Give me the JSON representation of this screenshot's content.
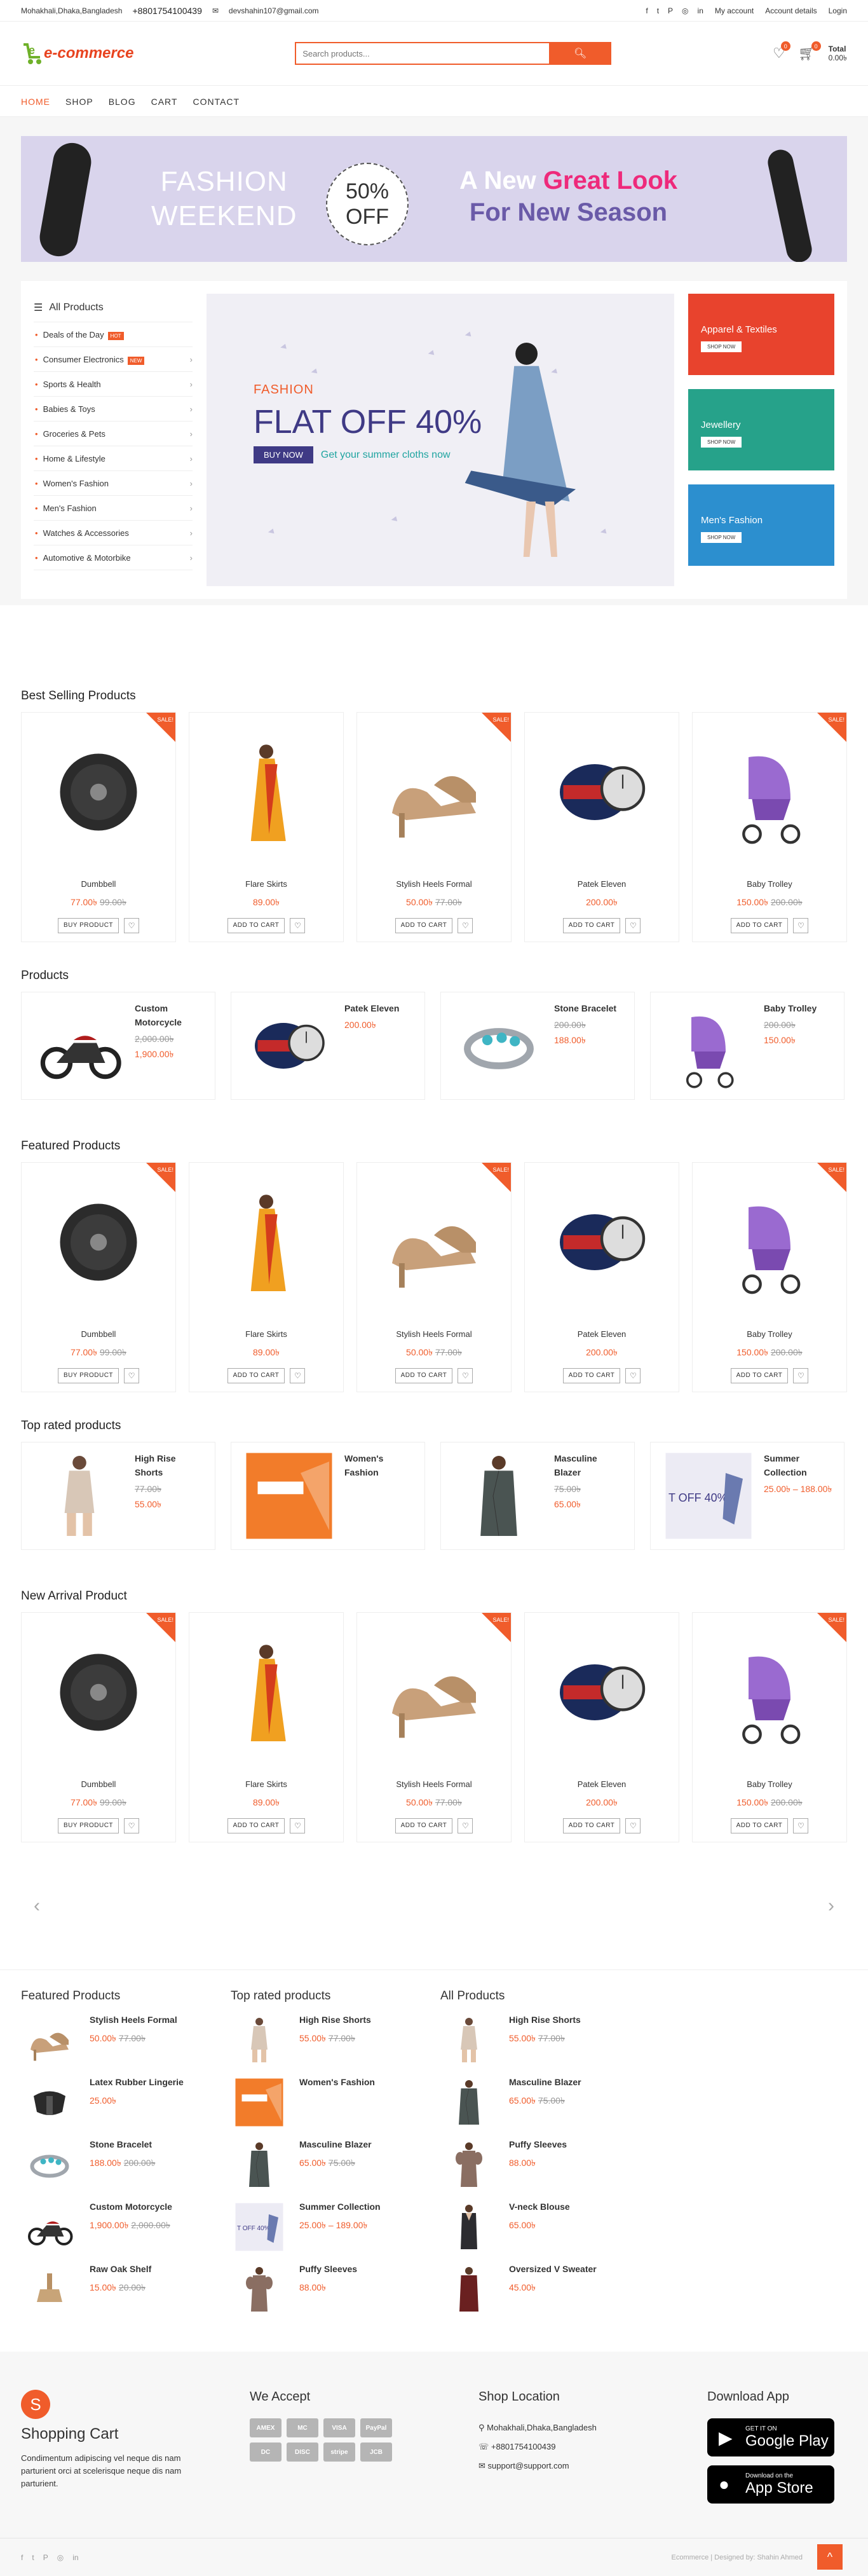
{
  "topbar": {
    "address": "Mohakhali,Dhaka,Bangladesh",
    "phone": "+8801754100439",
    "email": "devshahin107@gmail.com",
    "links": [
      "My account",
      "Account details",
      "Login"
    ]
  },
  "header": {
    "logo": "e-commerce",
    "search_placeholder": "Search products...",
    "wishlist_count": "0",
    "cart_count": "0",
    "cart_label": "Total",
    "cart_total": "0.00৳"
  },
  "nav": [
    "HOME",
    "SHOP",
    "BLOG",
    "CART",
    "CONTACT"
  ],
  "banner": {
    "line1": "FASHION",
    "line2": "WEEKEND",
    "badge1": "50%",
    "badge2": "OFF",
    "new": "A New",
    "great": "Great Look",
    "for": "For New Season"
  },
  "categories": {
    "title": "All Products",
    "items": [
      {
        "label": "Deals of the Day",
        "tag": "HOT",
        "tagcolor": "#f05c2b",
        "arrow": false
      },
      {
        "label": "Consumer Electronics",
        "tag": "NEW",
        "tagcolor": "#f05c2b",
        "arrow": true
      },
      {
        "label": "Sports & Health",
        "tag": "",
        "arrow": true
      },
      {
        "label": "Babies & Toys",
        "tag": "",
        "arrow": true
      },
      {
        "label": "Groceries & Pets",
        "tag": "",
        "arrow": true
      },
      {
        "label": "Home & Lifestyle",
        "tag": "",
        "arrow": true
      },
      {
        "label": "Women's Fashion",
        "tag": "",
        "arrow": true
      },
      {
        "label": "Men's Fashion",
        "tag": "",
        "arrow": true
      },
      {
        "label": "Watches & Accessories",
        "tag": "",
        "arrow": true
      },
      {
        "label": "Automotive & Motorbike",
        "tag": "",
        "arrow": true
      }
    ]
  },
  "hero": {
    "kicker": "FASHION",
    "headline": "FLAT OFF 40%",
    "button": "BUY NOW",
    "tagline": "Get your summer cloths now"
  },
  "side_banners": [
    {
      "title": "Apparel & Textiles",
      "btn": "SHOP NOW",
      "color": "#e8432d"
    },
    {
      "title": "Jewellery",
      "btn": "SHOP NOW",
      "color": "#26a28a"
    },
    {
      "title": "Men's Fashion",
      "btn": "SHOP NOW",
      "color": "#2c8fcf"
    }
  ],
  "best_selling": {
    "title": "Best Selling Products"
  },
  "products_title": "Products",
  "featured_title": "Featured Products",
  "top_rated_title": "Top rated products",
  "new_arrival_title": "New Arrival Product",
  "grid_products": [
    {
      "name": "Dumbbell",
      "price": "77.00৳",
      "old": "99.00৳",
      "btn": "BUY PRODUCT",
      "sale": true,
      "icon": "dumbbell-plate"
    },
    {
      "name": "Flare Skirts",
      "price": "89.00৳",
      "old": "",
      "btn": "ADD TO CART",
      "sale": false,
      "icon": "saree"
    },
    {
      "name": "Stylish Heels Formal",
      "price": "50.00৳",
      "old": "77.00৳",
      "btn": "ADD TO CART",
      "sale": true,
      "icon": "heels"
    },
    {
      "name": "Patek Eleven",
      "price": "200.00৳",
      "old": "",
      "btn": "ADD TO CART",
      "sale": false,
      "icon": "watch"
    },
    {
      "name": "Baby Trolley",
      "price": "150.00৳",
      "old": "200.00৳",
      "btn": "ADD TO CART",
      "sale": true,
      "icon": "stroller"
    }
  ],
  "products_h": [
    {
      "name": "Custom Motorcycle",
      "price": "1,900.00৳",
      "old": "2,000.00৳",
      "icon": "motorcycle"
    },
    {
      "name": "Patek Eleven",
      "price": "200.00৳",
      "old": "",
      "icon": "watch"
    },
    {
      "name": "Stone Bracelet",
      "price": "188.00৳",
      "old": "200.00৳",
      "icon": "bracelet"
    },
    {
      "name": "Baby Trolley",
      "price": "150.00৳",
      "old": "200.00৳",
      "icon": "stroller"
    }
  ],
  "top_rated_h": [
    {
      "name": "High Rise Shorts",
      "price": "55.00৳",
      "old": "77.00৳",
      "icon": "shorts"
    },
    {
      "name": "Women's Fashion",
      "price": "",
      "old": "",
      "icon": "fashion-banner"
    },
    {
      "name": "Masculine Blazer",
      "price": "65.00৳",
      "old": "75.00৳",
      "icon": "blazer"
    },
    {
      "name": "Summer Collection",
      "price": "25.00৳ – 188.00৳",
      "old": "",
      "icon": "summer"
    }
  ],
  "footer_lists": [
    {
      "title": "Featured Products",
      "items": [
        {
          "name": "Stylish Heels Formal",
          "price": "50.00৳",
          "old": "77.00৳",
          "icon": "heels"
        },
        {
          "name": "Latex Rubber Lingerie",
          "price": "25.00৳",
          "old": "",
          "icon": "lingerie"
        },
        {
          "name": "Stone Bracelet",
          "price": "188.00৳",
          "old": "200.00৳",
          "icon": "bracelet"
        },
        {
          "name": "Custom Motorcycle",
          "price": "1,900.00৳",
          "old": "2,000.00৳",
          "icon": "motorcycle"
        },
        {
          "name": "Raw Oak Shelf",
          "price": "15.00৳",
          "old": "20.00৳",
          "icon": "shelf"
        }
      ]
    },
    {
      "title": "Top rated products",
      "items": [
        {
          "name": "High Rise Shorts",
          "price": "55.00৳",
          "old": "77.00৳",
          "icon": "shorts"
        },
        {
          "name": "Women's Fashion",
          "price": "",
          "old": "",
          "icon": "fashion-banner"
        },
        {
          "name": "Masculine Blazer",
          "price": "65.00৳",
          "old": "75.00৳",
          "icon": "blazer"
        },
        {
          "name": "Summer Collection",
          "price": "25.00৳ – 189.00৳",
          "old": "",
          "icon": "summer"
        },
        {
          "name": "Puffy Sleeves",
          "price": "88.00৳",
          "old": "",
          "icon": "sleeves"
        }
      ]
    },
    {
      "title": "All Products",
      "items": [
        {
          "name": "High Rise Shorts",
          "price": "55.00৳",
          "old": "77.00৳",
          "icon": "shorts"
        },
        {
          "name": "Masculine Blazer",
          "price": "65.00৳",
          "old": "75.00৳",
          "icon": "blazer"
        },
        {
          "name": "Puffy Sleeves",
          "price": "88.00৳",
          "old": "",
          "icon": "sleeves"
        },
        {
          "name": "V-neck Blouse",
          "price": "65.00৳",
          "old": "",
          "icon": "blouse"
        },
        {
          "name": "Oversized V Sweater",
          "price": "45.00৳",
          "old": "",
          "icon": "sweater"
        }
      ]
    }
  ],
  "footer": {
    "brand": "Shopping Cart",
    "about": "Condimentum adipiscing vel neque dis nam parturient orci at scelerisque neque dis nam parturient.",
    "we_accept": "We Accept",
    "payments": [
      "AMEX",
      "MC",
      "VISA",
      "PayPal",
      "DC",
      "DISC",
      "stripe",
      "JCB"
    ],
    "shop_location": "Shop Location",
    "address": "Mohakhali,Dhaka,Bangladesh",
    "phone": "+8801754100439",
    "email": "support@support.com",
    "download": "Download App",
    "google_small": "GET IT ON",
    "google": "Google Play",
    "apple_small": "Download on the",
    "apple": "App Store",
    "copyright": "Ecommerce | Designed by: Shahin Ahmed"
  }
}
